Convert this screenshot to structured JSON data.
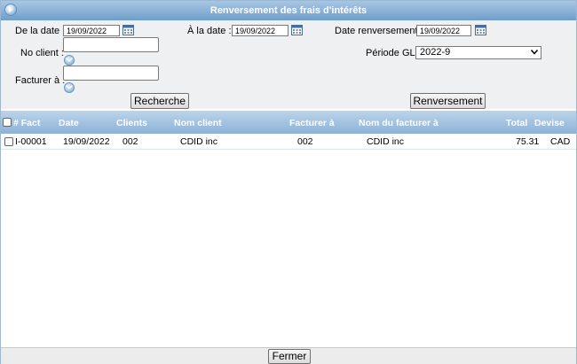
{
  "window": {
    "title": "Renversement des frais d'intérêts"
  },
  "form": {
    "de_la_date": {
      "label": "De la date :",
      "value": "19/09/2022"
    },
    "a_la_date": {
      "label": "À la date :",
      "value": "19/09/2022"
    },
    "date_renversement": {
      "label": "Date renversement :",
      "value": "19/09/2022"
    },
    "no_client": {
      "label": "No client :",
      "value": ""
    },
    "periode_gl": {
      "label": "Période GL :",
      "value": "2022-9"
    },
    "facturer_a": {
      "label": "Facturer à :",
      "value": ""
    },
    "recherche_label": "Recherche",
    "renversement_label": "Renversement"
  },
  "grid": {
    "columns": [
      "# Fact",
      "Date",
      "Clients",
      "Nom client",
      "Facturer à",
      "Nom du facturer à",
      "Total",
      "Devise"
    ],
    "rows": [
      {
        "fact": "I-00001",
        "date": "19/09/2022",
        "client": "002",
        "nom_client": "CDID inc",
        "facturer_a": "002",
        "nom_facturer_a": "CDID inc",
        "total": "75.31",
        "devise": "CAD"
      }
    ]
  },
  "footer": {
    "fermer_label": "Fermer"
  },
  "colors": {
    "title_bar": "#6f9dcb",
    "grid_header": "#8cb2d6",
    "form_bg": "#eef0f2"
  },
  "icons": {
    "title": "circle-arrow-icon",
    "calendar": "calendar-icon",
    "expand": "chevron-down-icon"
  }
}
